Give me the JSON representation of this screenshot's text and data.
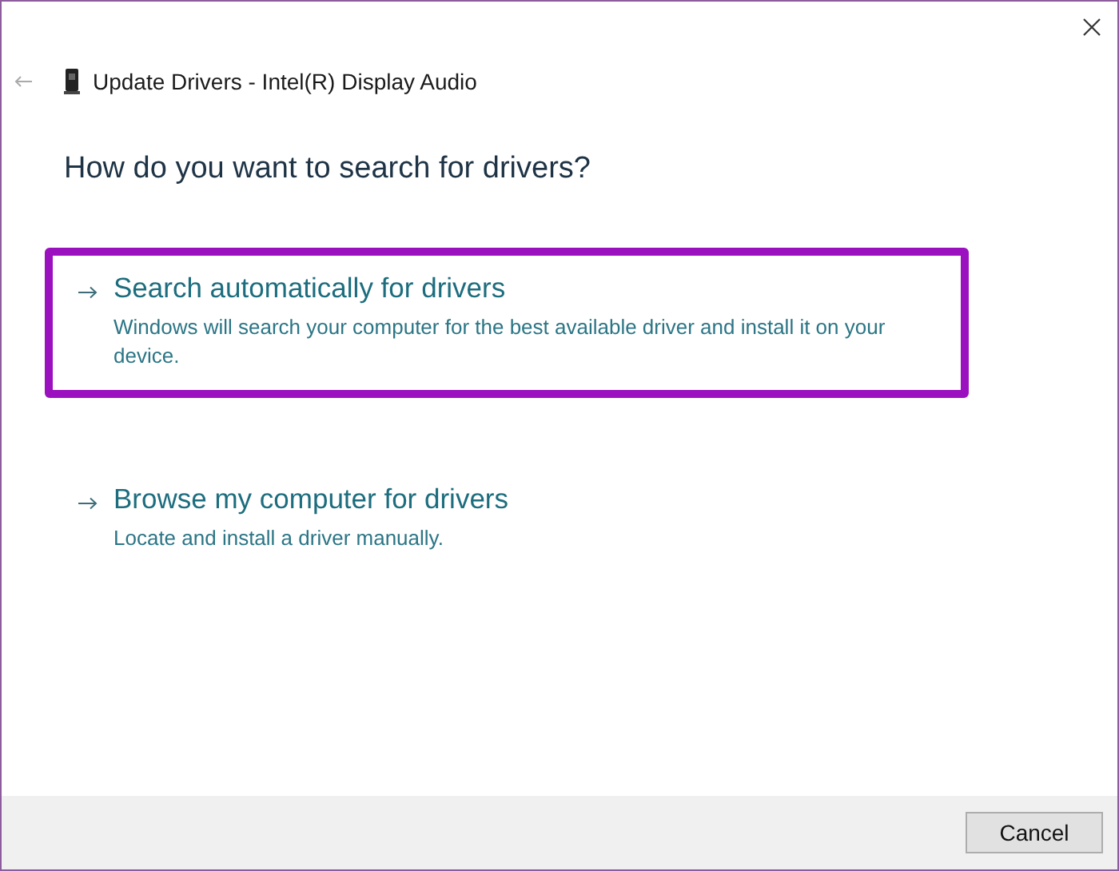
{
  "window": {
    "title": "Update Drivers - Intel(R) Display Audio"
  },
  "heading": "How do you want to search for drivers?",
  "options": [
    {
      "title": "Search automatically for drivers",
      "description": "Windows will search your computer for the best available driver and install it on your device.",
      "highlighted": true
    },
    {
      "title": "Browse my computer for drivers",
      "description": "Locate and install a driver manually.",
      "highlighted": false
    }
  ],
  "buttons": [
    "Cancel"
  ]
}
